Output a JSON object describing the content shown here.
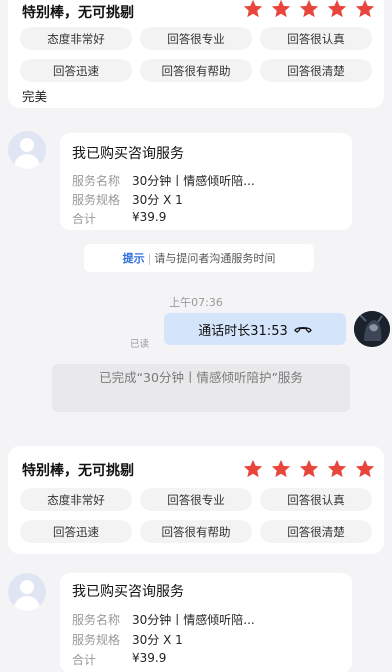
{
  "review_1": {
    "headline": "特别棒，无可挑剔",
    "stars": 5,
    "tags": [
      "态度非常好",
      "回答很专业",
      "回答很认真",
      "回答迅速",
      "回答很有帮助",
      "回答很清楚"
    ],
    "comment": "完美"
  },
  "order_1": {
    "title": "我已购买咨询服务",
    "rows": [
      {
        "label": "服务名称",
        "value": "30分钟丨情感倾听陪..."
      },
      {
        "label": "服务规格",
        "value": "30分 X 1"
      },
      {
        "label": "合计",
        "value": "¥39.9"
      }
    ]
  },
  "tip": {
    "label": "提示",
    "text": "请与提问者沟通服务时间"
  },
  "timestamp": "上午07:36",
  "call_message": {
    "text": "通话时长31:53",
    "status": "已读",
    "icon": "phone-icon"
  },
  "system_message": "已完成“30分钟丨情感倾听陪护”服务",
  "review_2": {
    "headline": "特别棒，无可挑剔",
    "stars": 5,
    "tags": [
      "态度非常好",
      "回答很专业",
      "回答很认真",
      "回答迅速",
      "回答很有帮助",
      "回答很清楚"
    ]
  },
  "order_2": {
    "title": "我已购买咨询服务",
    "rows": [
      {
        "label": "服务名称",
        "value": "30分钟丨情感倾听陪..."
      },
      {
        "label": "服务规格",
        "value": "30分 X 1"
      },
      {
        "label": "合计",
        "value": "¥39.9"
      }
    ]
  },
  "colors": {
    "star": "#e8453c",
    "accent": "#2f6fde",
    "bubble": "#d4e4fb"
  }
}
